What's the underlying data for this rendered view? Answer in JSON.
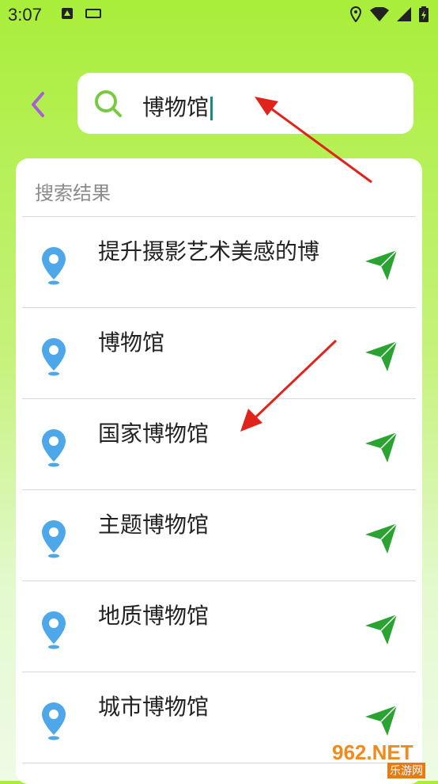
{
  "status": {
    "time": "3:07"
  },
  "search": {
    "query": "博物馆"
  },
  "results": {
    "title": "搜索结果",
    "items": [
      {
        "label": "提升摄影艺术美感的博"
      },
      {
        "label": "博物馆"
      },
      {
        "label": "国家博物馆"
      },
      {
        "label": "主题博物馆"
      },
      {
        "label": "地质博物馆"
      },
      {
        "label": "城市博物馆"
      }
    ]
  },
  "watermark": {
    "main": "962.NET",
    "sub": "乐游网"
  },
  "colors": {
    "accent": "#a65fd6",
    "search_icon": "#7ac943",
    "pin": "#4da7e8",
    "nav": "#2aa332",
    "annotation": "#e0241c"
  }
}
